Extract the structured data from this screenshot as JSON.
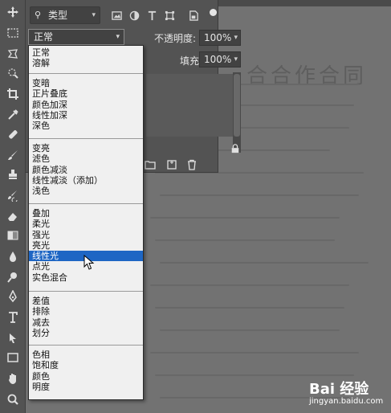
{
  "layers_panel": {
    "filter_kind_label": "类型",
    "blend_mode_value": "正常",
    "opacity_label": "不透明度:",
    "opacity_value": "100%",
    "fill_label": "填充:",
    "fill_value": "100%"
  },
  "blend_menu": {
    "groups": [
      [
        "正常",
        "溶解"
      ],
      [
        "变暗",
        "正片叠底",
        "颜色加深",
        "线性加深",
        "深色"
      ],
      [
        "变亮",
        "滤色",
        "颜色减淡",
        "线性减淡（添加）",
        "浅色"
      ],
      [
        "叠加",
        "柔光",
        "强光",
        "亮光",
        "线性光",
        "点光",
        "实色混合"
      ],
      [
        "差值",
        "排除",
        "减去",
        "划分"
      ],
      [
        "色相",
        "饱和度",
        "颜色",
        "明度"
      ]
    ],
    "highlighted": "线性光",
    "highlight_color": "#1e66c4"
  },
  "canvas": {
    "document_title": "合合作合同"
  },
  "watermark": {
    "logo_text": "Bai 经验",
    "url": "jingyan.baidu.com"
  }
}
